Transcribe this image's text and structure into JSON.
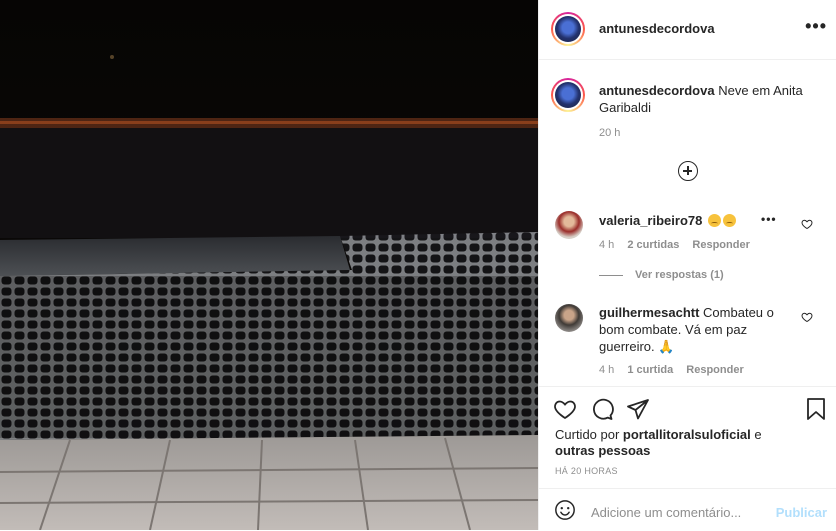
{
  "post": {
    "author": "antunesdecordova",
    "caption_author": "antunesdecordova",
    "caption_text": "Neve em Anita Garibaldi",
    "caption_time": "20 h",
    "more_label": "•••"
  },
  "comments": [
    {
      "user": "valeria_ribeiro78",
      "text": "",
      "time": "4 h",
      "likes": "2 curtidas",
      "reply": "Responder",
      "view_replies": "Ver respostas (1)"
    },
    {
      "user": "guilhermesachtt",
      "text": "Combateu o bom combate. Vá em paz guerreiro. 🙏",
      "time": "4 h",
      "likes": "1 curtida",
      "reply": "Responder"
    }
  ],
  "likes": {
    "prefix": "Curtido por ",
    "user": "portallitoralsuloficial",
    "suffix": " e",
    "others": "outras pessoas"
  },
  "timestamp": "HÁ 20 HORAS",
  "add_comment": {
    "placeholder": "Adicione um comentário...",
    "publish": "Publicar"
  },
  "icons": [
    "more-icon",
    "add-icon",
    "heart-icon",
    "comment-icon",
    "share-icon",
    "save-icon",
    "emoji-icon"
  ]
}
